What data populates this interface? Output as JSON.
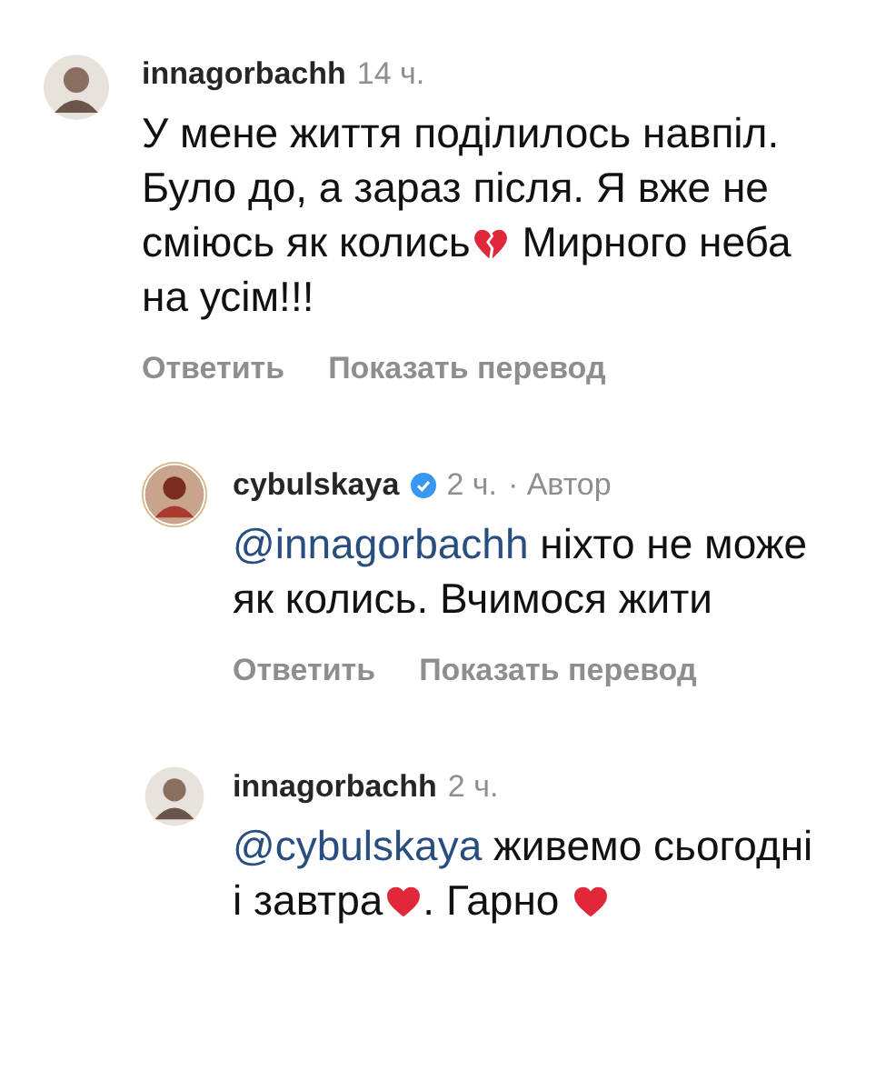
{
  "comments": [
    {
      "username": "innagorbachh",
      "verified": false,
      "time": "14 ч.",
      "reply": false,
      "body": [
        {
          "kind": "text",
          "text": "У мене життя поділилось навпіл. Було до, а зараз після. Я вже не сміюсь як колись"
        },
        {
          "kind": "broken_heart"
        },
        {
          "kind": "text",
          "text": " Мирного неба на усім!!!"
        }
      ],
      "actions": [
        "Ответить",
        "Показать перевод"
      ]
    },
    {
      "username": "cybulskaya",
      "verified": true,
      "time": "2 ч.",
      "author_label": "· Автор",
      "reply": true,
      "body": [
        {
          "kind": "mention",
          "text": "@innagorbachh"
        },
        {
          "kind": "text",
          "text": " ніхто не може як колись. Вчимося жити"
        }
      ],
      "actions": [
        "Ответить",
        "Показать перевод"
      ]
    },
    {
      "username": "innagorbachh",
      "verified": false,
      "time": "2 ч.",
      "reply": true,
      "body": [
        {
          "kind": "mention",
          "text": "@cybulskaya"
        },
        {
          "kind": "text",
          "text": " живемо сьогодні і завтра"
        },
        {
          "kind": "heart"
        },
        {
          "kind": "text",
          "text": ". Гарно "
        },
        {
          "kind": "heart"
        }
      ]
    }
  ]
}
